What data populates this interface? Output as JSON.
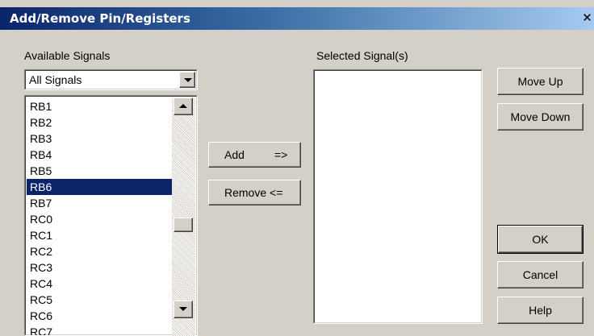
{
  "window": {
    "title": "Add/Remove Pin/Registers",
    "close_glyph": "✕"
  },
  "available": {
    "label": "Available Signals",
    "filter": {
      "selected": "All Signals"
    },
    "items": [
      "RB1",
      "RB2",
      "RB3",
      "RB4",
      "RB5",
      "RB6",
      "RB7",
      "RC0",
      "RC1",
      "RC2",
      "RC3",
      "RC4",
      "RC5",
      "RC6",
      "RC7"
    ],
    "selected_item": "RB6"
  },
  "transfer": {
    "add_label": "Add",
    "add_arrow": "=>",
    "remove_label": "Remove <="
  },
  "selected": {
    "label": "Selected Signal(s)",
    "items": []
  },
  "buttons": {
    "move_up": "Move Up",
    "move_down": "Move Down",
    "ok": "OK",
    "cancel": "Cancel",
    "help": "Help"
  },
  "colors": {
    "selection": "#0a246a",
    "face": "#d4d0c8"
  }
}
